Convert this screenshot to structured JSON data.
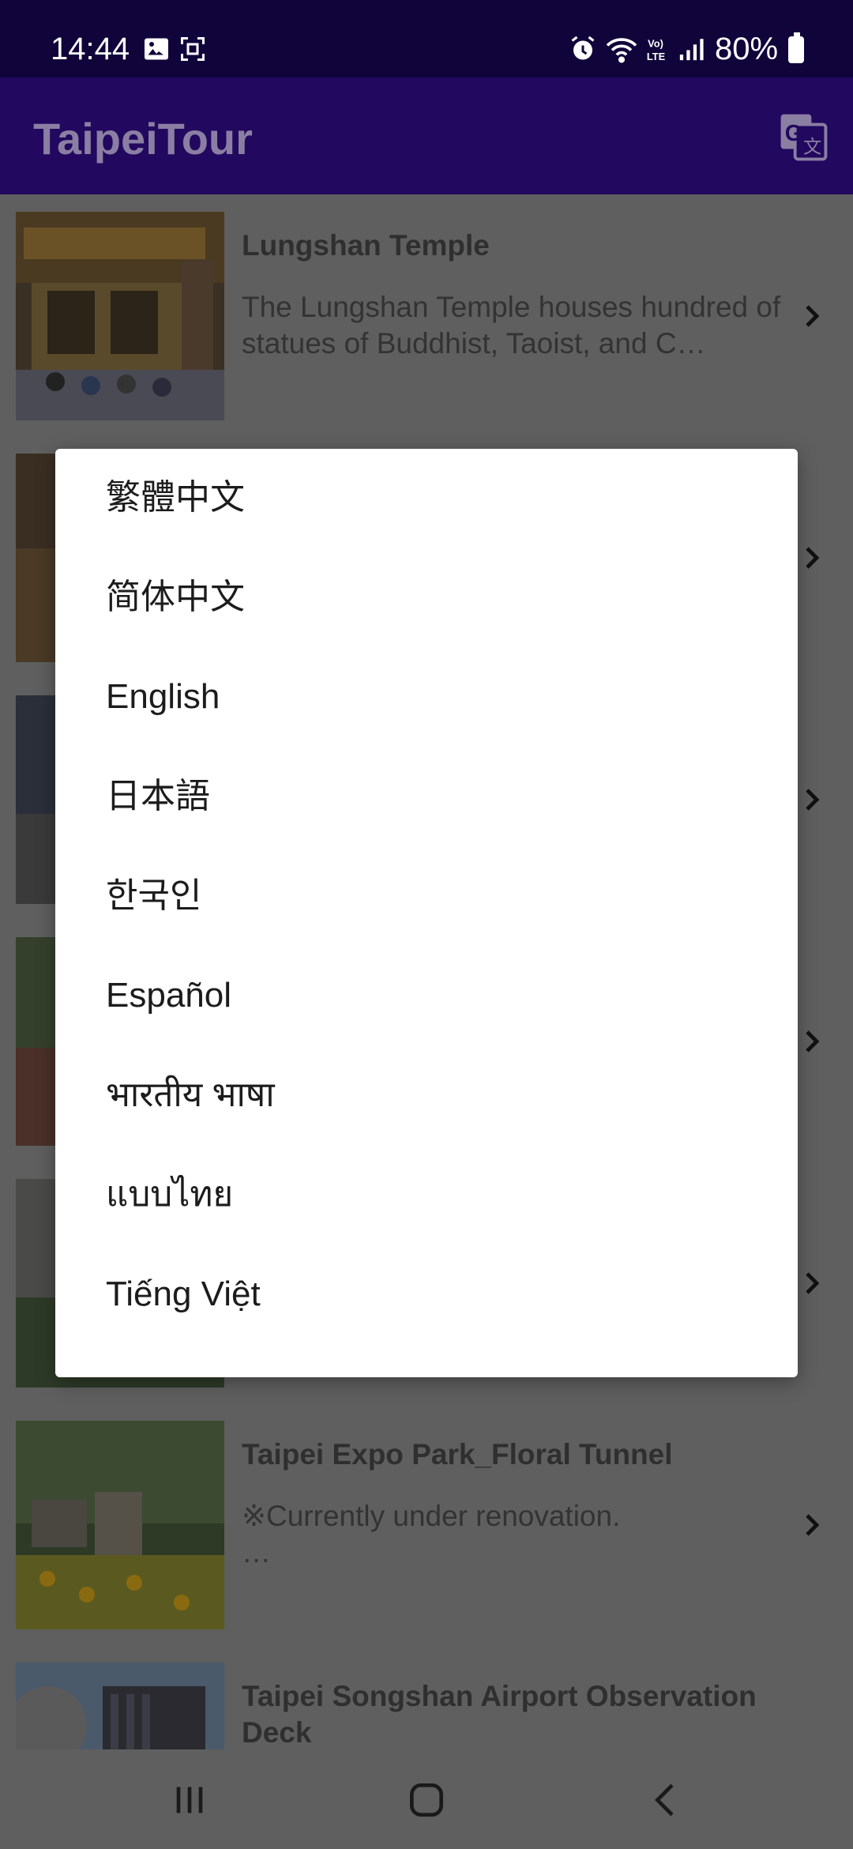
{
  "status_bar": {
    "time": "14:44",
    "battery": "80%",
    "icons": [
      "image-icon",
      "screenshot-icon",
      "alarm-icon",
      "wifi-icon",
      "volte-icon",
      "signal-icon",
      "battery-icon"
    ]
  },
  "app_bar": {
    "title": "TaipeiTour",
    "action_icon": "translate-icon"
  },
  "list": {
    "items": [
      {
        "title": "Lungshan Temple",
        "description": "The Lungshan Temple houses hundred of statues of Buddhist, Taoist, and C…"
      },
      {
        "title": "",
        "description": ""
      },
      {
        "title": "",
        "description": ""
      },
      {
        "title": "",
        "description": ""
      },
      {
        "title": "",
        "description": ""
      },
      {
        "title": "Taipei Expo Park_Floral Tunnel",
        "description": "※Currently under renovation.\n…"
      },
      {
        "title": "Taipei Songshan Airport Observation Deck",
        "description": ""
      }
    ]
  },
  "language_dialog": {
    "options": [
      "繁體中文",
      "简体中文",
      "English",
      "日本語",
      "한국인",
      "Español",
      "भारतीय भाषा",
      "แบบไทย",
      "Tiếng Việt"
    ]
  },
  "nav_bar": {
    "buttons": [
      "recent-apps-icon",
      "home-icon",
      "back-icon"
    ]
  },
  "colors": {
    "status_bar": "#10043a",
    "app_bar": "#22085f",
    "scrim": "#5f5f5f",
    "dialog": "#ffffff"
  }
}
